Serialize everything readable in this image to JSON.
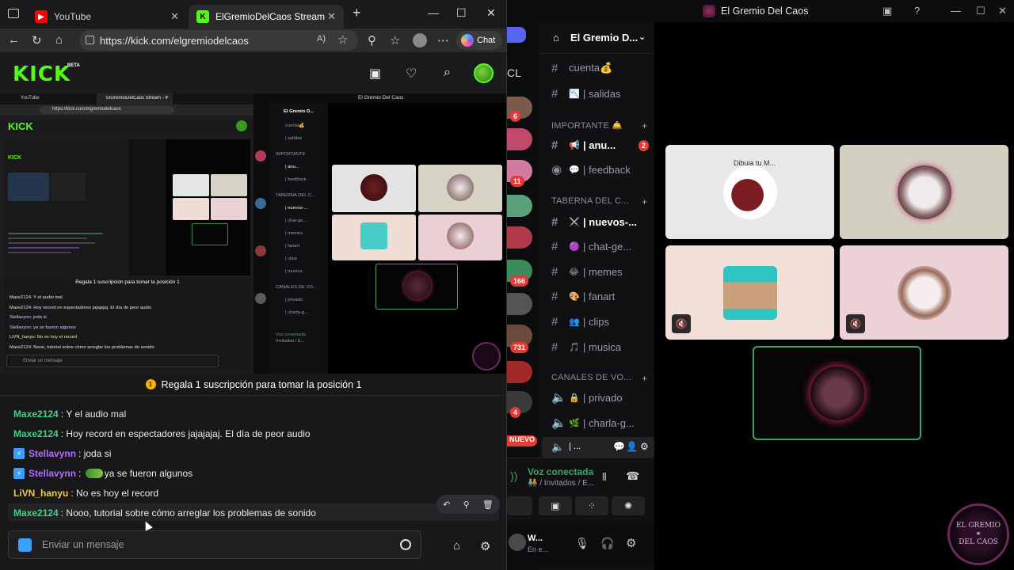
{
  "browser": {
    "tabs": [
      {
        "label": "YouTube",
        "icon": "youtube-icon"
      },
      {
        "label": "ElGremioDelCaos Stream - Watch",
        "icon": "kick-icon"
      }
    ],
    "url": "https://kick.com/elgremiodelcaos",
    "chat_button": "Chat"
  },
  "kick": {
    "logo": "KICK",
    "logo_badge": "BETA"
  },
  "chat": {
    "promo": "Regala 1 suscripción para tomar la posición 1",
    "messages": [
      {
        "user": "Maxe2124",
        "color": "#3fd48a",
        "text": "Y el audio mal"
      },
      {
        "user": "Maxe2124",
        "color": "#3fd48a",
        "text": "Hoy record en espectadores jajajajaj. El día de peor audio"
      },
      {
        "user": "Stellavynn",
        "color": "#b46cff",
        "text": "joda si"
      },
      {
        "user": "Stellavynn",
        "color": "#b46cff",
        "text": "ya se fueron algunos"
      },
      {
        "user": "LiVN_hanyu",
        "color": "#f2c94c",
        "text": "No es hoy el record"
      },
      {
        "user": "Maxe2124",
        "color": "#3fd48a",
        "text": "Nooo, tutorial sobre cómo arreglar los problemas de sonido"
      }
    ],
    "input_placeholder": "Enviar un mensaje"
  },
  "discord": {
    "window_title": "El Gremio Del Caos",
    "server_name": "El Gremio D...",
    "channels_top": [
      {
        "name": "cuenta💰",
        "icon": ""
      },
      {
        "name": "| salidas",
        "icon": "📉"
      }
    ],
    "cat_importante": "IMPORTANTE 🛎️",
    "channels_importante": [
      {
        "name": "| anu...",
        "icon": "📢",
        "badge": "2"
      },
      {
        "name": "| feedback",
        "icon": "💬"
      }
    ],
    "cat_taberna": "TABERNA DEL C...",
    "channels_taberna": [
      {
        "name": "| nuevos-...",
        "icon": "⚔️"
      },
      {
        "name": "| chat-ge...",
        "icon": "🟣"
      },
      {
        "name": "| memes",
        "icon": "😂"
      },
      {
        "name": "| fanart",
        "icon": "🎨"
      },
      {
        "name": "| clips",
        "icon": "👥"
      },
      {
        "name": "| musica",
        "icon": "🎵"
      }
    ],
    "cat_voz": "CANALES DE VO...",
    "channels_voz": [
      {
        "name": "| privado",
        "icon": "🔒"
      },
      {
        "name": "| charla-g...",
        "icon": "🌿"
      },
      {
        "name": "| ...",
        "icon": "🧑‍🤝‍🧑"
      }
    ],
    "voice_status": "Voz conectada",
    "voice_channel": "🧑‍🤝‍🧑 / Invitados / E...",
    "guild_badges": [
      "6",
      "11",
      "166",
      "731",
      "4"
    ],
    "guild_new": "NUEVO",
    "guild_top": "CL",
    "user_name": "W...",
    "user_status": "En e...",
    "tile_text": "Dibuja tu M...",
    "emblem": "EL GREMIO DEL CAOS"
  },
  "mini": {
    "promo": "Regala 1 suscripción para tomar la posición 1",
    "lines": [
      "Maxe2124: Y el audio mal",
      "Maxe2124: Hoy record en espectadores jajajajaj. El día de peor audio",
      "Stellavynn: joda si",
      "Stellavynn: ya se fueron algunos",
      "LiVN_hanyu: No es hoy el record",
      "Maxe2124: Nooo, tutorial sobre cómo arreglar los problemas de sonido"
    ],
    "input_placeholder": "Enviar un mensaje",
    "discord_title": "El Gremio Del Caos",
    "server_name": "El Gremio D...",
    "channels": [
      "cuenta💰",
      "| salidas",
      "IMPORTANTE",
      "| anu...",
      "| feedback",
      "TABERNA DEL C...",
      "| nuevos-...",
      "| chat-ge...",
      "| memes",
      "| fanart",
      "| clips",
      "| musica",
      "CANALES DE VO...",
      "| privado",
      "| charla-g..."
    ],
    "voice": "Voz conectada",
    "voice_sub": "Invitados / E...",
    "tiny_url": "https://kick.com/elgremiodelcaos",
    "tiny_tab": "ElGremioDelCaos Stream - Watch",
    "tiny_youtube": "YouTube"
  }
}
